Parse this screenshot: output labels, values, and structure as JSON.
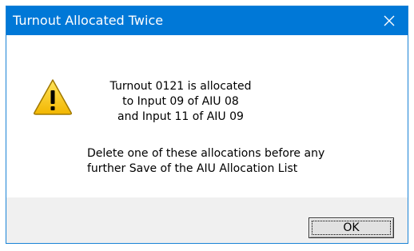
{
  "window": {
    "title": "Turnout Allocated Twice",
    "close_icon": "close-icon"
  },
  "message": {
    "icon": "warning-icon",
    "lines": [
      "Turnout 0121 is allocated",
      "to Input 09 of AIU 08",
      "and Input 11 of AIU 09"
    ],
    "instruction_lines": [
      "Delete one of these allocations before any",
      "further Save of the AIU Allocation List"
    ]
  },
  "buttons": {
    "ok_label": "OK"
  },
  "colors": {
    "titlebar": "#0078d7",
    "title_text": "#ffffff",
    "footer": "#f0f0f0",
    "warning_fill": "#f5c400"
  }
}
